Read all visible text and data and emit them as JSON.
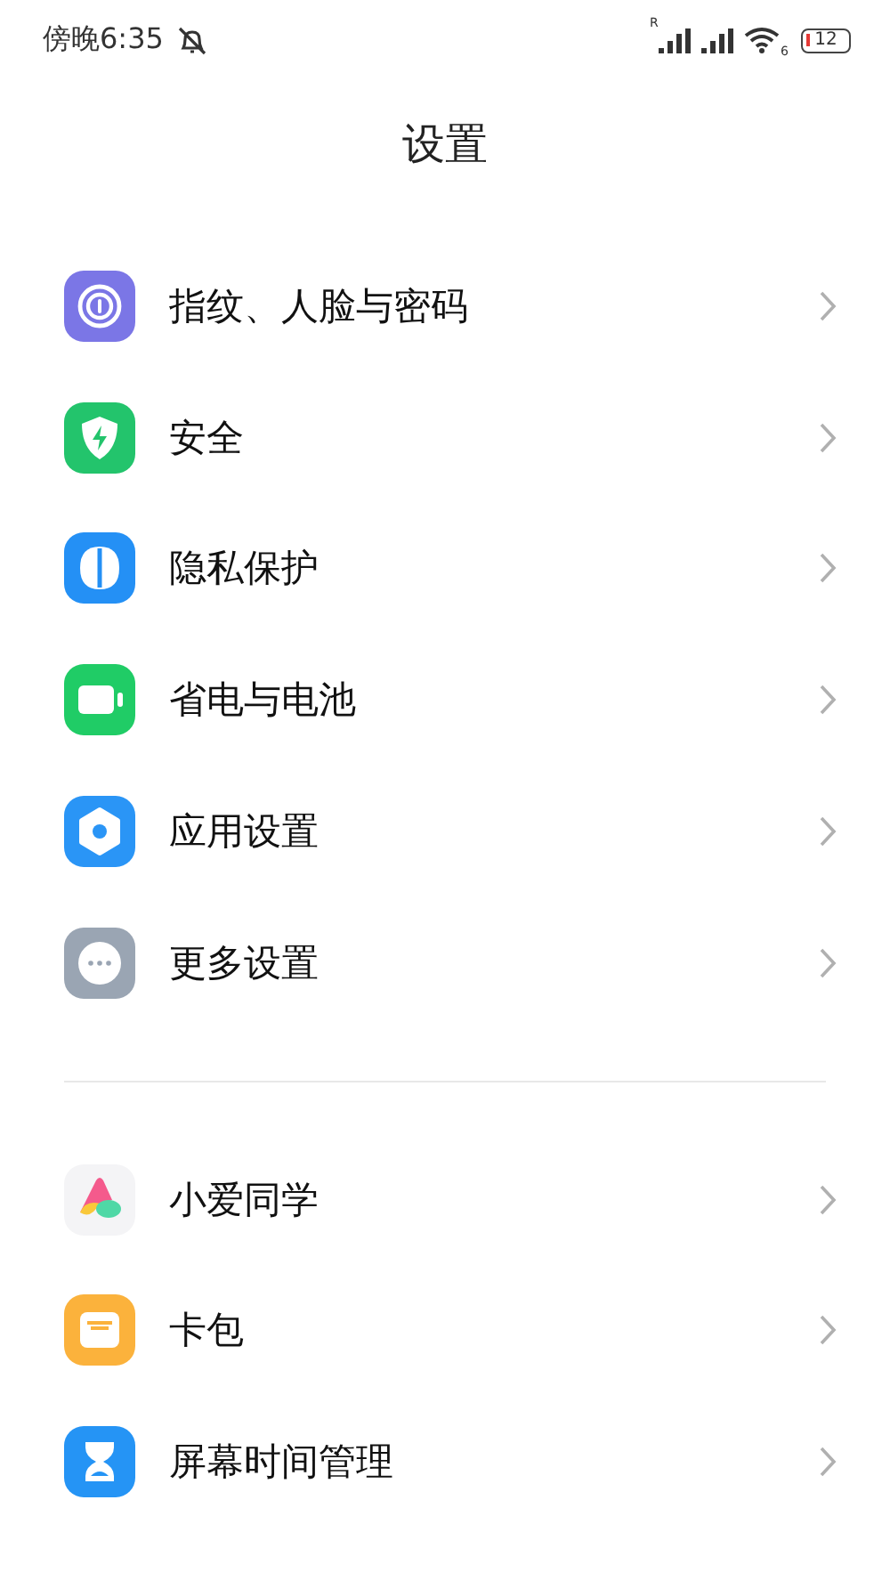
{
  "status_bar": {
    "time": "傍晚6:35",
    "roaming_mark": "R",
    "wifi_mark": "6",
    "battery": "12"
  },
  "title": "设置",
  "sections": [
    {
      "items": [
        {
          "label": "指纹、人脸与密码",
          "color": "#7b76e6"
        },
        {
          "label": "安全",
          "color": "#23c46c"
        },
        {
          "label": "隐私保护",
          "color": "#2490f5"
        },
        {
          "label": "省电与电池",
          "color": "#20cc66"
        },
        {
          "label": "应用设置",
          "color": "#2a95f6"
        },
        {
          "label": "更多设置",
          "color": "#9aa5b3"
        }
      ]
    },
    {
      "items": [
        {
          "label": "小爱同学",
          "color": "#f4f4f6"
        },
        {
          "label": "卡包",
          "color": "#fbb23c"
        },
        {
          "label": "屏幕时间管理",
          "color": "#2594f5"
        }
      ]
    }
  ]
}
